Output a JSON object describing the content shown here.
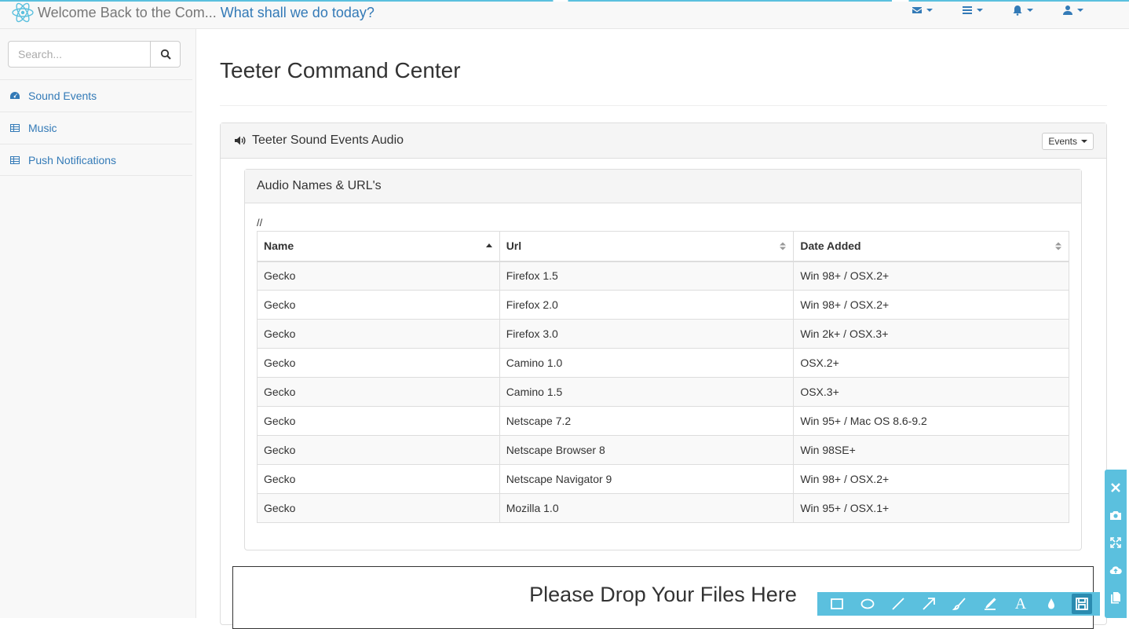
{
  "header": {
    "welcome": "Welcome Back to the Com...",
    "prompt": "What shall we do today?",
    "icons": [
      "envelope-icon",
      "tasks-icon",
      "bell-icon",
      "user-icon"
    ]
  },
  "sidebar": {
    "search_placeholder": "Search...",
    "items": [
      {
        "label": "Sound Events",
        "icon": "dashboard-icon"
      },
      {
        "label": "Music",
        "icon": "table-icon"
      },
      {
        "label": "Push Notifications",
        "icon": "table-icon"
      }
    ]
  },
  "main": {
    "title": "Teeter Command Center",
    "panel_title": "Teeter Sound Events Audio",
    "events_button": "Events",
    "inner_panel_title": "Audio Names & URL's",
    "slashes": "//",
    "table": {
      "columns": [
        "Name",
        "Url",
        "Date Added"
      ],
      "rows": [
        [
          "Gecko",
          "Firefox 1.5",
          "Win 98+ / OSX.2+"
        ],
        [
          "Gecko",
          "Firefox 2.0",
          "Win 98+ / OSX.2+"
        ],
        [
          "Gecko",
          "Firefox 3.0",
          "Win 2k+ / OSX.3+"
        ],
        [
          "Gecko",
          "Camino 1.0",
          "OSX.2+"
        ],
        [
          "Gecko",
          "Camino 1.5",
          "OSX.3+"
        ],
        [
          "Gecko",
          "Netscape 7.2",
          "Win 95+ / Mac OS 8.6-9.2"
        ],
        [
          "Gecko",
          "Netscape Browser 8",
          "Win 98SE+"
        ],
        [
          "Gecko",
          "Netscape Navigator 9",
          "Win 98+ / OSX.2+"
        ],
        [
          "Gecko",
          "Mozilla 1.0",
          "Win 95+ / OSX.1+"
        ]
      ]
    },
    "dropzone": "Please Drop Your Files Here"
  },
  "tools": {
    "text_tool": "A"
  },
  "colors": {
    "link": "#337ab7",
    "toolbar": "#5bc0de"
  }
}
